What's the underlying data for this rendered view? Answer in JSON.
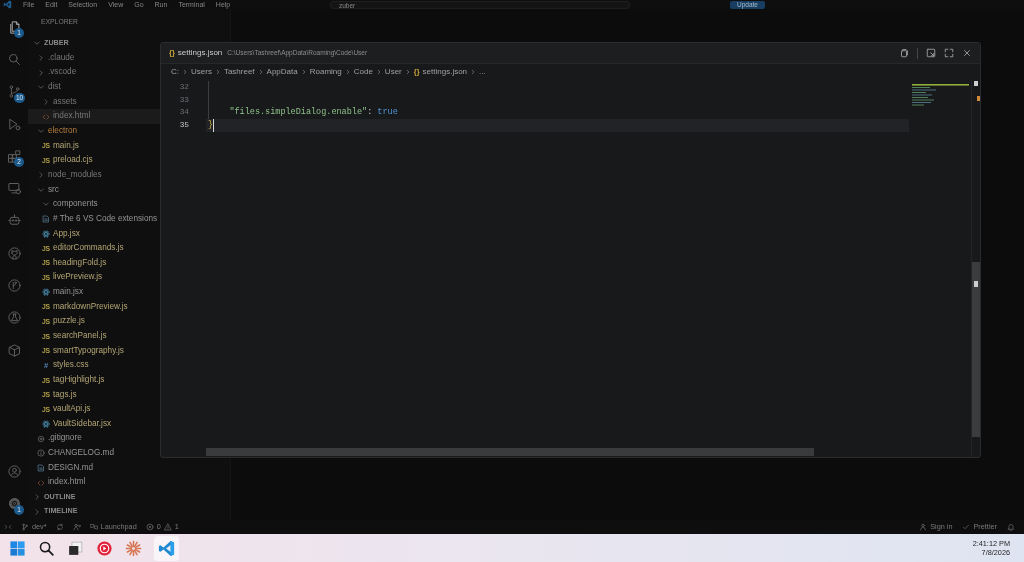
{
  "menu_bar": {
    "menus": [
      "File",
      "Edit",
      "Selection",
      "View",
      "Go",
      "Run",
      "Terminal",
      "Help"
    ],
    "search": {
      "value": "zuber"
    },
    "update_button": "Update"
  },
  "activity_bar": {
    "items": [
      {
        "kind": "explorer",
        "selected": true,
        "badge": "1"
      },
      {
        "kind": "search",
        "selected": false
      },
      {
        "kind": "source-control",
        "selected": false,
        "badge": "10"
      },
      {
        "kind": "run-debug",
        "selected": false
      },
      {
        "kind": "extensions",
        "selected": false,
        "badge": "2"
      },
      {
        "kind": "remote",
        "selected": false
      },
      {
        "kind": "robot",
        "selected": false
      },
      {
        "kind": "cat",
        "selected": false
      },
      {
        "kind": "branch-circle",
        "selected": false
      },
      {
        "kind": "flask-circle",
        "selected": false
      },
      {
        "kind": "package",
        "selected": false
      }
    ],
    "bottom_items": [
      {
        "kind": "account"
      },
      {
        "kind": "settings",
        "badge": "1"
      }
    ]
  },
  "sidebar": {
    "title": "EXPLORER",
    "sections": [
      {
        "title": "ZUBER",
        "expanded": true,
        "items": [
          {
            "name": ".claude",
            "kind": "folder",
            "expanded": false,
            "selected": false,
            "ignored": true,
            "modified": false,
            "warning": false
          },
          {
            "name": ".vscode",
            "kind": "folder",
            "expanded": false,
            "selected": false,
            "ignored": true,
            "modified": false,
            "warning": false
          },
          {
            "name": "dist",
            "kind": "folder",
            "expanded": true,
            "selected": false,
            "ignored": true,
            "modified": false,
            "warning": false,
            "children": [
              {
                "name": "assets",
                "kind": "folder",
                "expanded": false,
                "selected": false,
                "ignored": true,
                "modified": false,
                "warning": false
              },
              {
                "name": "index.html",
                "kind": "html",
                "selected": true,
                "ignored": true,
                "modified": false,
                "warning": false
              }
            ]
          },
          {
            "name": "electron",
            "kind": "folder",
            "expanded": true,
            "selected": false,
            "ignored": false,
            "modified": false,
            "warning": true,
            "children": [
              {
                "name": "main.js",
                "kind": "js",
                "icon": "JS",
                "selected": false,
                "ignored": false,
                "modified": true,
                "warning": false
              },
              {
                "name": "preload.cjs",
                "kind": "js",
                "icon": "JS",
                "selected": false,
                "ignored": false,
                "modified": true,
                "warning": false
              }
            ]
          },
          {
            "name": "node_modules",
            "kind": "folder",
            "expanded": false,
            "selected": false,
            "ignored": true,
            "modified": false,
            "warning": false
          },
          {
            "name": "src",
            "kind": "folder",
            "expanded": true,
            "selected": false,
            "ignored": false,
            "modified": false,
            "warning": false,
            "children": [
              {
                "name": "components",
                "kind": "folder",
                "expanded": true,
                "selected": false,
                "ignored": false,
                "modified": false,
                "warning": false
              },
              {
                "name": "# The 6 VS Code extensions",
                "kind": "md",
                "selected": false,
                "ignored": false,
                "modified": false,
                "warning": false
              },
              {
                "name": "App.jsx",
                "kind": "jsx",
                "selected": false,
                "ignored": false,
                "modified": true,
                "warning": false
              },
              {
                "name": "editorCommands.js",
                "kind": "js",
                "icon": "JS",
                "selected": false,
                "ignored": false,
                "modified": true,
                "warning": false
              },
              {
                "name": "headingFold.js",
                "kind": "js",
                "icon": "JS",
                "selected": false,
                "ignored": false,
                "modified": true,
                "warning": false
              },
              {
                "name": "livePreview.js",
                "kind": "js",
                "icon": "JS",
                "selected": false,
                "ignored": false,
                "modified": true,
                "warning": false
              },
              {
                "name": "main.jsx",
                "kind": "jsx",
                "selected": false,
                "ignored": false,
                "modified": false,
                "warning": false
              },
              {
                "name": "markdownPreview.js",
                "kind": "js",
                "icon": "JS",
                "selected": false,
                "ignored": false,
                "modified": true,
                "warning": false
              },
              {
                "name": "puzzle.js",
                "kind": "js",
                "icon": "JS",
                "selected": false,
                "ignored": false,
                "modified": true,
                "warning": false
              },
              {
                "name": "searchPanel.js",
                "kind": "js",
                "icon": "JS",
                "selected": false,
                "ignored": false,
                "modified": true,
                "warning": false
              },
              {
                "name": "smartTypography.js",
                "kind": "js",
                "icon": "JS",
                "selected": false,
                "ignored": false,
                "modified": true,
                "warning": false
              },
              {
                "name": "styles.css",
                "kind": "css",
                "icon": "#",
                "selected": false,
                "ignored": false,
                "modified": true,
                "warning": false
              },
              {
                "name": "tagHighlight.js",
                "kind": "js",
                "icon": "JS",
                "selected": false,
                "ignored": false,
                "modified": true,
                "warning": false
              },
              {
                "name": "tags.js",
                "kind": "js",
                "icon": "JS",
                "selected": false,
                "ignored": false,
                "modified": true,
                "warning": false
              },
              {
                "name": "vaultApi.js",
                "kind": "js",
                "icon": "JS",
                "selected": false,
                "ignored": false,
                "modified": true,
                "warning": false
              },
              {
                "name": "VaultSidebar.jsx",
                "kind": "jsx",
                "selected": false,
                "ignored": false,
                "modified": true,
                "warning": false
              }
            ]
          },
          {
            "name": ".gitignore",
            "kind": "config",
            "selected": false,
            "ignored": false,
            "modified": false,
            "warning": false
          },
          {
            "name": "CHANGELOG.md",
            "kind": "info",
            "selected": false,
            "ignored": false,
            "modified": false,
            "warning": false
          },
          {
            "name": "DESIGN.md",
            "kind": "md",
            "selected": false,
            "ignored": false,
            "modified": false,
            "warning": false
          },
          {
            "name": "index.html",
            "kind": "html",
            "selected": false,
            "ignored": false,
            "modified": false,
            "warning": false
          }
        ]
      },
      {
        "title": "OUTLINE",
        "expanded": false
      },
      {
        "title": "TIMELINE",
        "expanded": false
      }
    ]
  },
  "settings_editor": {
    "tab": {
      "icon": "{}",
      "title": "settings.json",
      "path": "C:\\Users\\Tashreef\\AppData\\Roaming\\Code\\User"
    },
    "breadcrumb": [
      {
        "text": "C:"
      },
      {
        "text": "Users"
      },
      {
        "text": "Tashreef"
      },
      {
        "text": "AppData"
      },
      {
        "text": "Roaming"
      },
      {
        "text": "Code"
      },
      {
        "text": "User"
      },
      {
        "text": "settings.json",
        "icon": "{}"
      },
      {
        "text": "..."
      }
    ],
    "lines": [
      {
        "number": "32",
        "current": false,
        "indent_guide": true
      },
      {
        "number": "33",
        "current": false,
        "indent_guide": true
      },
      {
        "number": "34",
        "current": false,
        "indent_guide": true,
        "tokens": [
          {
            "kind": "key",
            "text": "    \"files.simpleDialog.enable\""
          },
          {
            "kind": "punct",
            "text": ": "
          },
          {
            "kind": "bool",
            "text": "true"
          }
        ]
      },
      {
        "number": "35",
        "current": true,
        "indent_guide": false,
        "tokens": [
          {
            "kind": "bracket",
            "text": "}"
          }
        ]
      }
    ]
  },
  "status_bar": {
    "left": [
      {
        "kind": "remote"
      },
      {
        "kind": "branch",
        "text": "dev*"
      },
      {
        "kind": "sync"
      },
      {
        "kind": "live-share"
      },
      {
        "kind": "launchpad",
        "text": "Launchpad"
      },
      {
        "kind": "problems",
        "errors": "0",
        "warnings": "1"
      }
    ],
    "right": [
      {
        "kind": "account",
        "text": "Sign in"
      },
      {
        "kind": "prettier",
        "text": "Prettier"
      },
      {
        "kind": "notifications"
      }
    ]
  },
  "taskbar": {
    "apps": [
      {
        "kind": "start",
        "active": false
      },
      {
        "kind": "search",
        "active": false
      },
      {
        "kind": "task-view",
        "active": false
      },
      {
        "kind": "music",
        "active": false
      },
      {
        "kind": "asterisk",
        "active": false
      },
      {
        "kind": "code-editor",
        "active": true
      }
    ],
    "clock": {
      "time": "2:41:12 PM",
      "date": "7/8/2026"
    }
  }
}
